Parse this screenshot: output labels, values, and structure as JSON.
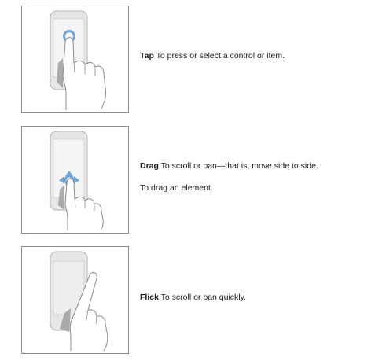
{
  "gestures": [
    {
      "term": "Tap",
      "definition": "To press or select a control or item.",
      "illustration_icon": "tap-gesture-icon"
    },
    {
      "term": "Drag",
      "definition": "To scroll or pan—that is, move side to side.",
      "note": "To drag an element.",
      "illustration_icon": "drag-gesture-icon"
    },
    {
      "term": "Flick",
      "definition": "To scroll or pan quickly.",
      "illustration_icon": "flick-gesture-icon"
    }
  ],
  "colors": {
    "frame_border": "#8a8a8a",
    "device_fill": "#e6e6e6",
    "device_stroke": "#b5b5b5",
    "screen_fill": "#f4f4f4",
    "hand_stroke": "#8a8a8a",
    "touch_accent": "#6fa6d6"
  }
}
